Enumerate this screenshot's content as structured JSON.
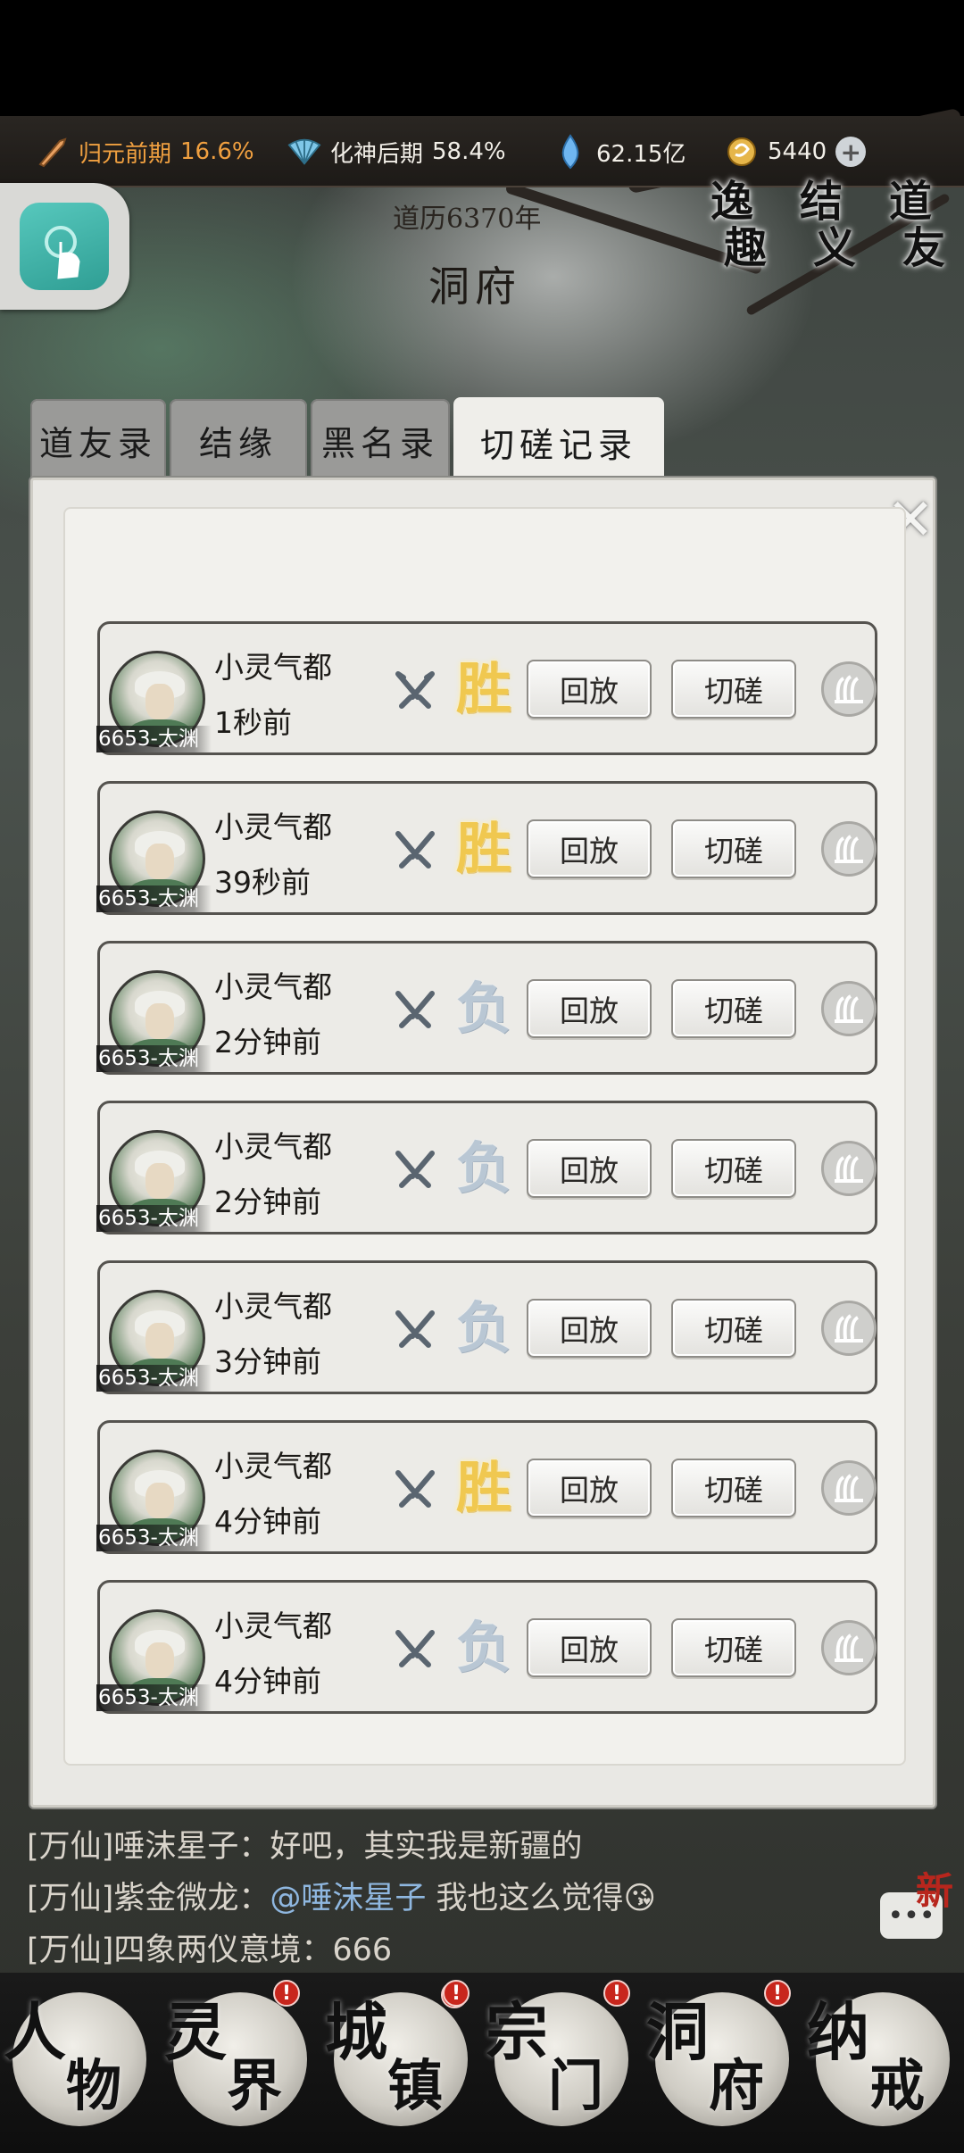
{
  "status": {
    "cultivation_stage": "归元前期",
    "cultivation_pct": "16.6%",
    "spirit_stage": "化神后期",
    "spirit_pct": "58.4%",
    "spirit_stones": "62.15亿",
    "currency": "5440",
    "accent_color": "#f0a040"
  },
  "header": {
    "era": "道历6370年",
    "place": "洞府"
  },
  "top_right_badges": [
    {
      "top": "逸",
      "bottom": "趣"
    },
    {
      "top": "结",
      "bottom": "义"
    },
    {
      "top": "道",
      "bottom": "友"
    }
  ],
  "tabs": [
    {
      "label": "道友录"
    },
    {
      "label": "结缘"
    },
    {
      "label": "黑名录"
    },
    {
      "label": "切磋记录",
      "active": true
    }
  ],
  "records": [
    {
      "name": "小灵气都",
      "time": "1秒前",
      "server": "6653-太渊",
      "result": "胜",
      "outcome": "win"
    },
    {
      "name": "小灵气都",
      "time": "39秒前",
      "server": "6653-太渊",
      "result": "胜",
      "outcome": "win"
    },
    {
      "name": "小灵气都",
      "time": "2分钟前",
      "server": "6653-太渊",
      "result": "负",
      "outcome": "lose"
    },
    {
      "name": "小灵气都",
      "time": "2分钟前",
      "server": "6653-太渊",
      "result": "负",
      "outcome": "lose"
    },
    {
      "name": "小灵气都",
      "time": "3分钟前",
      "server": "6653-太渊",
      "result": "负",
      "outcome": "lose"
    },
    {
      "name": "小灵气都",
      "time": "4分钟前",
      "server": "6653-太渊",
      "result": "胜",
      "outcome": "win"
    },
    {
      "name": "小灵气都",
      "time": "4分钟前",
      "server": "6653-太渊",
      "result": "负",
      "outcome": "lose"
    }
  ],
  "buttons": {
    "replay": "回放",
    "spar": "切磋"
  },
  "chat": [
    {
      "channel": "[万仙]",
      "sender": "唾沫星子",
      "text": "：好吧，其实我是新疆的"
    },
    {
      "channel": "[万仙]",
      "sender": "紫金微龙",
      "text": "：",
      "mention": "@唾沫星子",
      "tail": " 我也这么觉得😘"
    },
    {
      "channel": "[万仙]",
      "sender": "四象两仪意境",
      "text": "：666"
    }
  ],
  "chat_new_badge": "新",
  "nav": [
    {
      "a": "人",
      "b": "物",
      "dot": false
    },
    {
      "a": "灵",
      "b": "界",
      "dot": true
    },
    {
      "a": "城",
      "b": "镇",
      "dot": true
    },
    {
      "a": "宗",
      "b": "门",
      "dot": true
    },
    {
      "a": "洞",
      "b": "府",
      "dot": true
    },
    {
      "a": "纳",
      "b": "戒",
      "dot": false
    }
  ]
}
